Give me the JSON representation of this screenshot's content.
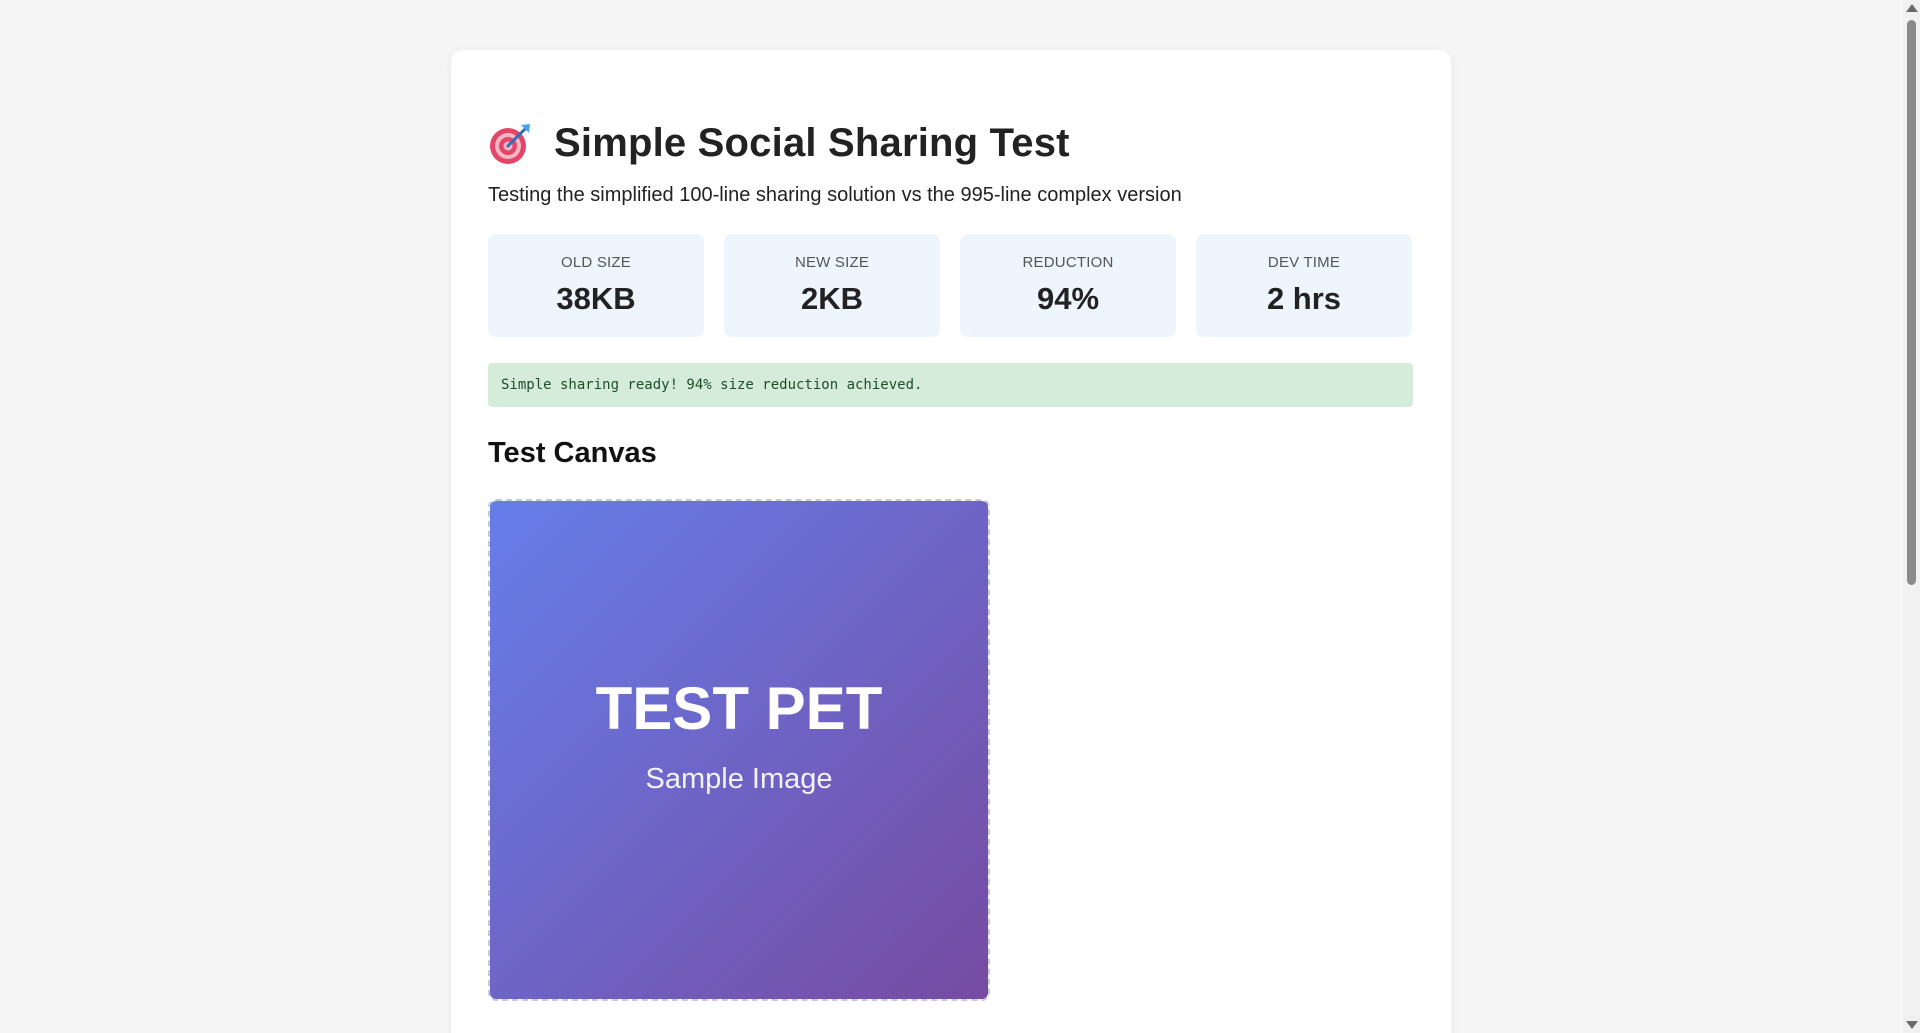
{
  "header": {
    "title": "Simple Social Sharing Test",
    "title_icon": "target-dart-icon",
    "subtitle": "Testing the simplified 100-line sharing solution vs the 995-line complex version"
  },
  "stats": [
    {
      "label": "OLD SIZE",
      "value": "38KB"
    },
    {
      "label": "NEW SIZE",
      "value": "2KB"
    },
    {
      "label": "REDUCTION",
      "value": "94%"
    },
    {
      "label": "DEV TIME",
      "value": "2 hrs"
    }
  ],
  "status": {
    "message": "Simple sharing ready! 94% size reduction achieved.",
    "color": "#d4ecd9"
  },
  "canvas_section": {
    "heading": "Test Canvas",
    "image_title": "TEST PET",
    "image_subtitle": "Sample Image",
    "gradient_start": "#667eea",
    "gradient_end": "#764ba2"
  }
}
